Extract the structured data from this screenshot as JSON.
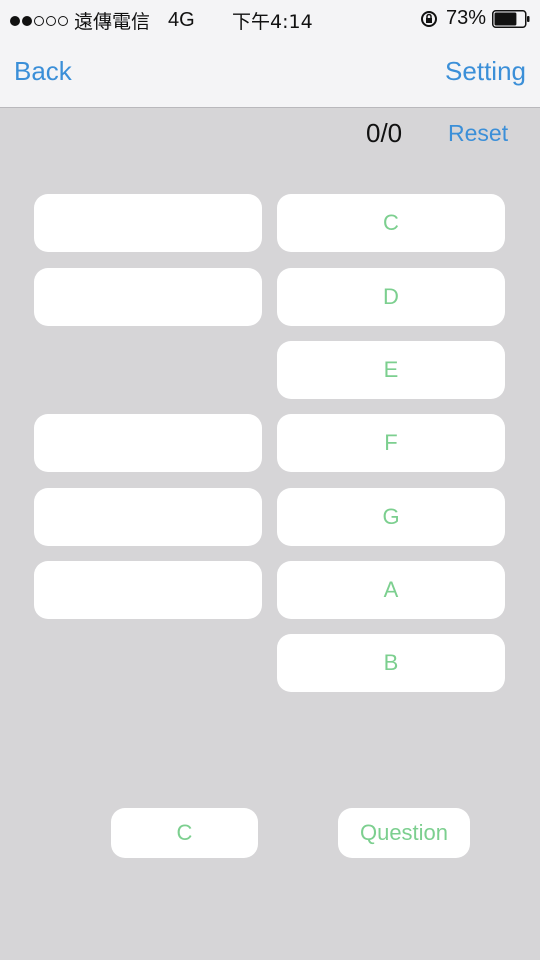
{
  "status_bar": {
    "signal_dots_filled": 2,
    "signal_dots_total": 5,
    "carrier": "遠傳電信",
    "network": "4G",
    "time": "下午4:14",
    "battery_percent": "73%",
    "battery_level": 0.73
  },
  "nav": {
    "back_label": "Back",
    "setting_label": "Setting"
  },
  "score": "0/0",
  "reset_label": "Reset",
  "notes": [
    "C",
    "D",
    "E",
    "F",
    "G",
    "A",
    "B"
  ],
  "bottom": {
    "current_note": "C",
    "question_label": "Question"
  },
  "colors": {
    "accent_blue": "#3b8fd8",
    "note_green": "#7ccf8f",
    "background": "#d6d5d7"
  }
}
